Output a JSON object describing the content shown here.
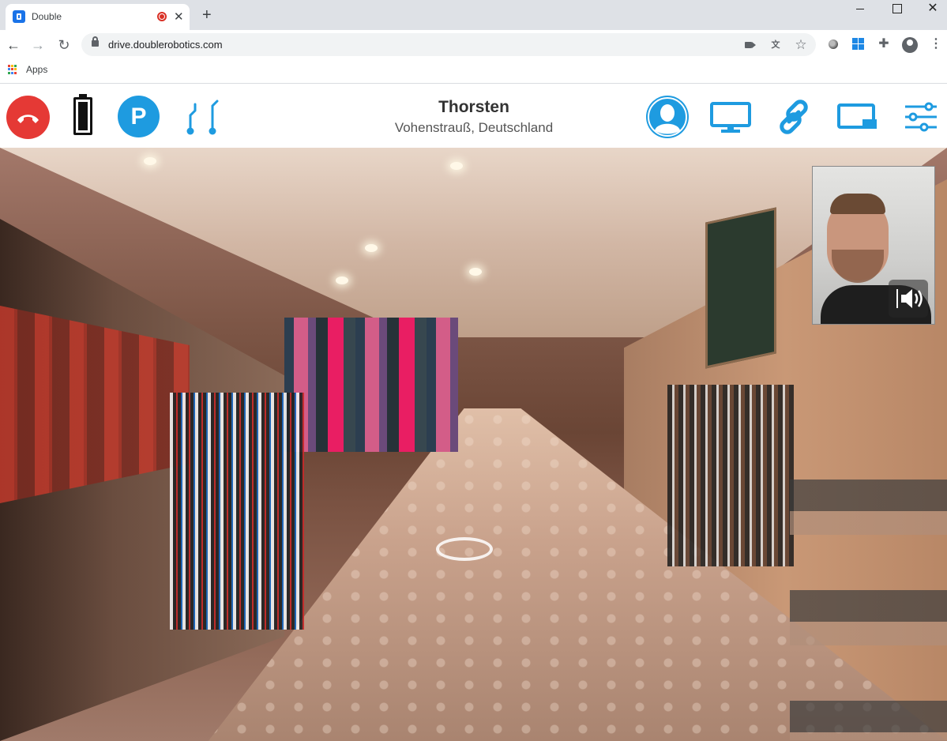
{
  "browser": {
    "tab": {
      "title": "Double"
    },
    "url": "drive.doublerobotics.com",
    "bookmarks": {
      "apps_label": "Apps"
    }
  },
  "header": {
    "caller_name": "Thorsten",
    "caller_location": "Vohenstrauß, Deutschland",
    "parking_label": "P"
  },
  "colors": {
    "accent": "#1e9be0",
    "hangup": "#e53935"
  },
  "icons": {
    "hangup": "phone-hangup-icon",
    "battery": "battery-icon",
    "pole": "pole-height-icon",
    "user": "user-icon",
    "screen": "monitor-icon",
    "link": "link-icon",
    "share": "screen-share-icon",
    "settings": "sliders-icon",
    "volume": "volume-icon"
  }
}
